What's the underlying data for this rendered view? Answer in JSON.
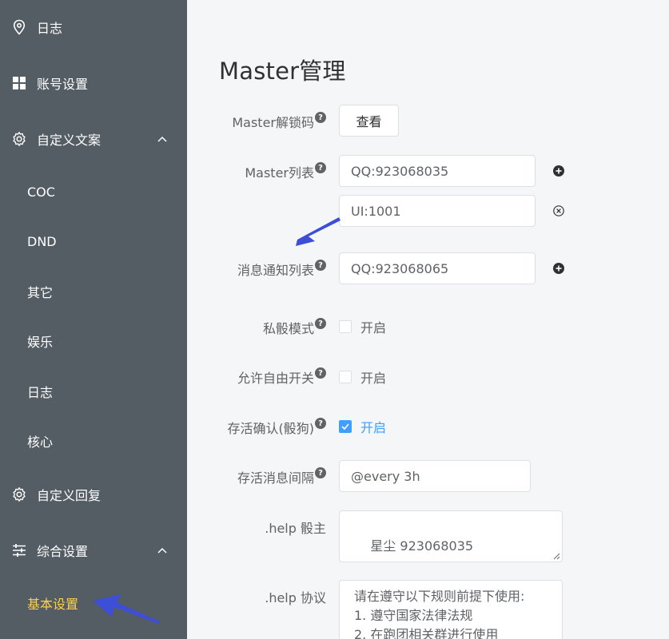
{
  "sidebar": {
    "items": [
      {
        "label": "日志",
        "icon": "location-pin-icon"
      },
      {
        "label": "账号设置",
        "icon": "grid-icon"
      },
      {
        "label": "自定义文案",
        "icon": "gear-icon",
        "expanded": true,
        "children": [
          "COC",
          "DND",
          "其它",
          "娱乐",
          "日志",
          "核心"
        ]
      },
      {
        "label": "自定义回复",
        "icon": "gear-icon"
      },
      {
        "label": "综合设置",
        "icon": "sliders-icon",
        "expanded": true,
        "children": [
          "基本设置"
        ]
      }
    ],
    "active_child": "基本设置",
    "active_color": "#ffd04b",
    "bg_color": "#545c64"
  },
  "main": {
    "title": "Master管理",
    "master_code": {
      "label": "Master解锁码",
      "button": "查看"
    },
    "master_list": {
      "label": "Master列表",
      "values": [
        "QQ:923068035",
        "UI:1001"
      ]
    },
    "notify_list": {
      "label": "消息通知列表",
      "values": [
        "QQ:923068065"
      ]
    },
    "private_dice": {
      "label": "私骰模式",
      "option": "开启",
      "checked": false
    },
    "free_switch": {
      "label": "允许自由开关",
      "option": "开启",
      "checked": false
    },
    "alive_confirm": {
      "label": "存活确认(骰狗)",
      "option": "开启",
      "checked": true
    },
    "alive_interval": {
      "label": "存活消息间隔",
      "value": "@every 3h"
    },
    "help_master": {
      "label": ".help 骰主",
      "value": "星尘 923068035"
    },
    "help_protocol": {
      "label": ".help 协议",
      "value": "请在遵守以下规则前提下使用:\n1. 遵守国家法律法规\n2. 在跑团相关群进行使用"
    },
    "accent_color": "#409eff"
  }
}
